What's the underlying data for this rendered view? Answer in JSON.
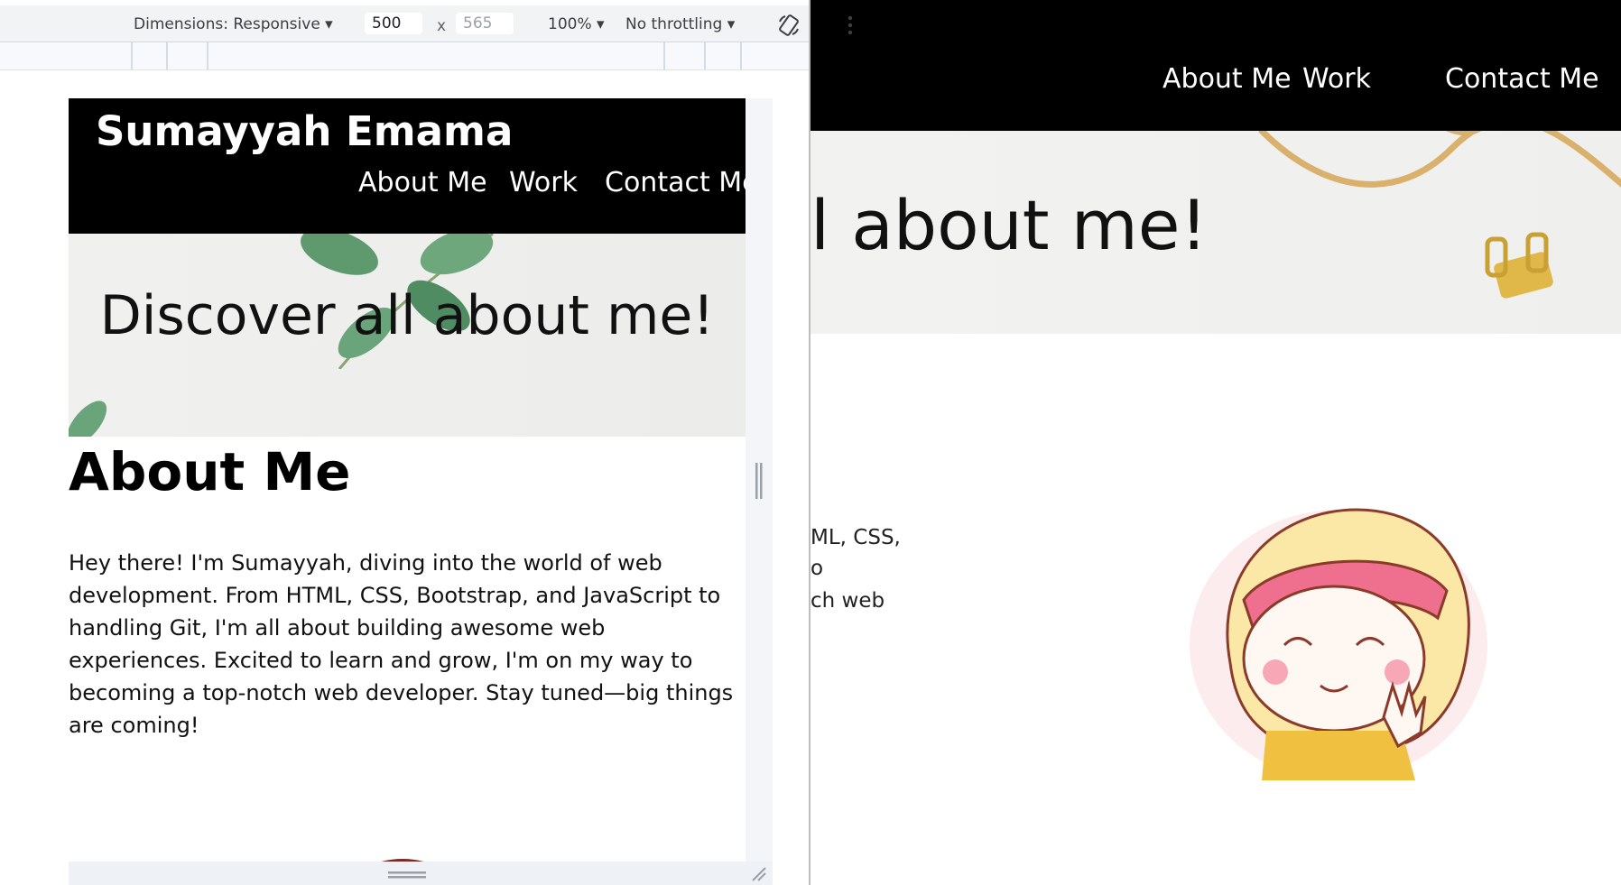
{
  "devtools": {
    "dimensions_label": "Dimensions: Responsive",
    "width_value": "500",
    "height_placeholder": "565",
    "times_sign": "x",
    "zoom": "100%",
    "throttling": "No throttling",
    "rotate_icon": "rotate-icon",
    "more_icon": "more-vert-icon"
  },
  "site": {
    "brand": "Sumayyah Emama",
    "nav": [
      "About Me",
      "Work",
      "Contact Me"
    ],
    "hero_title": "Discover all about me!",
    "about_title": "About Me",
    "about_text": "Hey there! I'm Sumayyah, diving into the world of web development. From HTML, CSS, Bootstrap, and JavaScript to handling Git, I'm all about building awesome web experiences. Excited to learn and grow, I'm on my way to becoming a top-notch web developer. Stay tuned—big things are coming!"
  },
  "background_page": {
    "nav": [
      "About Me",
      "Work",
      "Contact Me"
    ],
    "hero_fragment": "l about me!",
    "para_fragments": [
      "ML, CSS,",
      "o",
      "ch web"
    ]
  },
  "colors": {
    "nav_bg": "#000000",
    "nav_text": "#ffffff",
    "toolbar_bg": "#f1f3f4"
  }
}
